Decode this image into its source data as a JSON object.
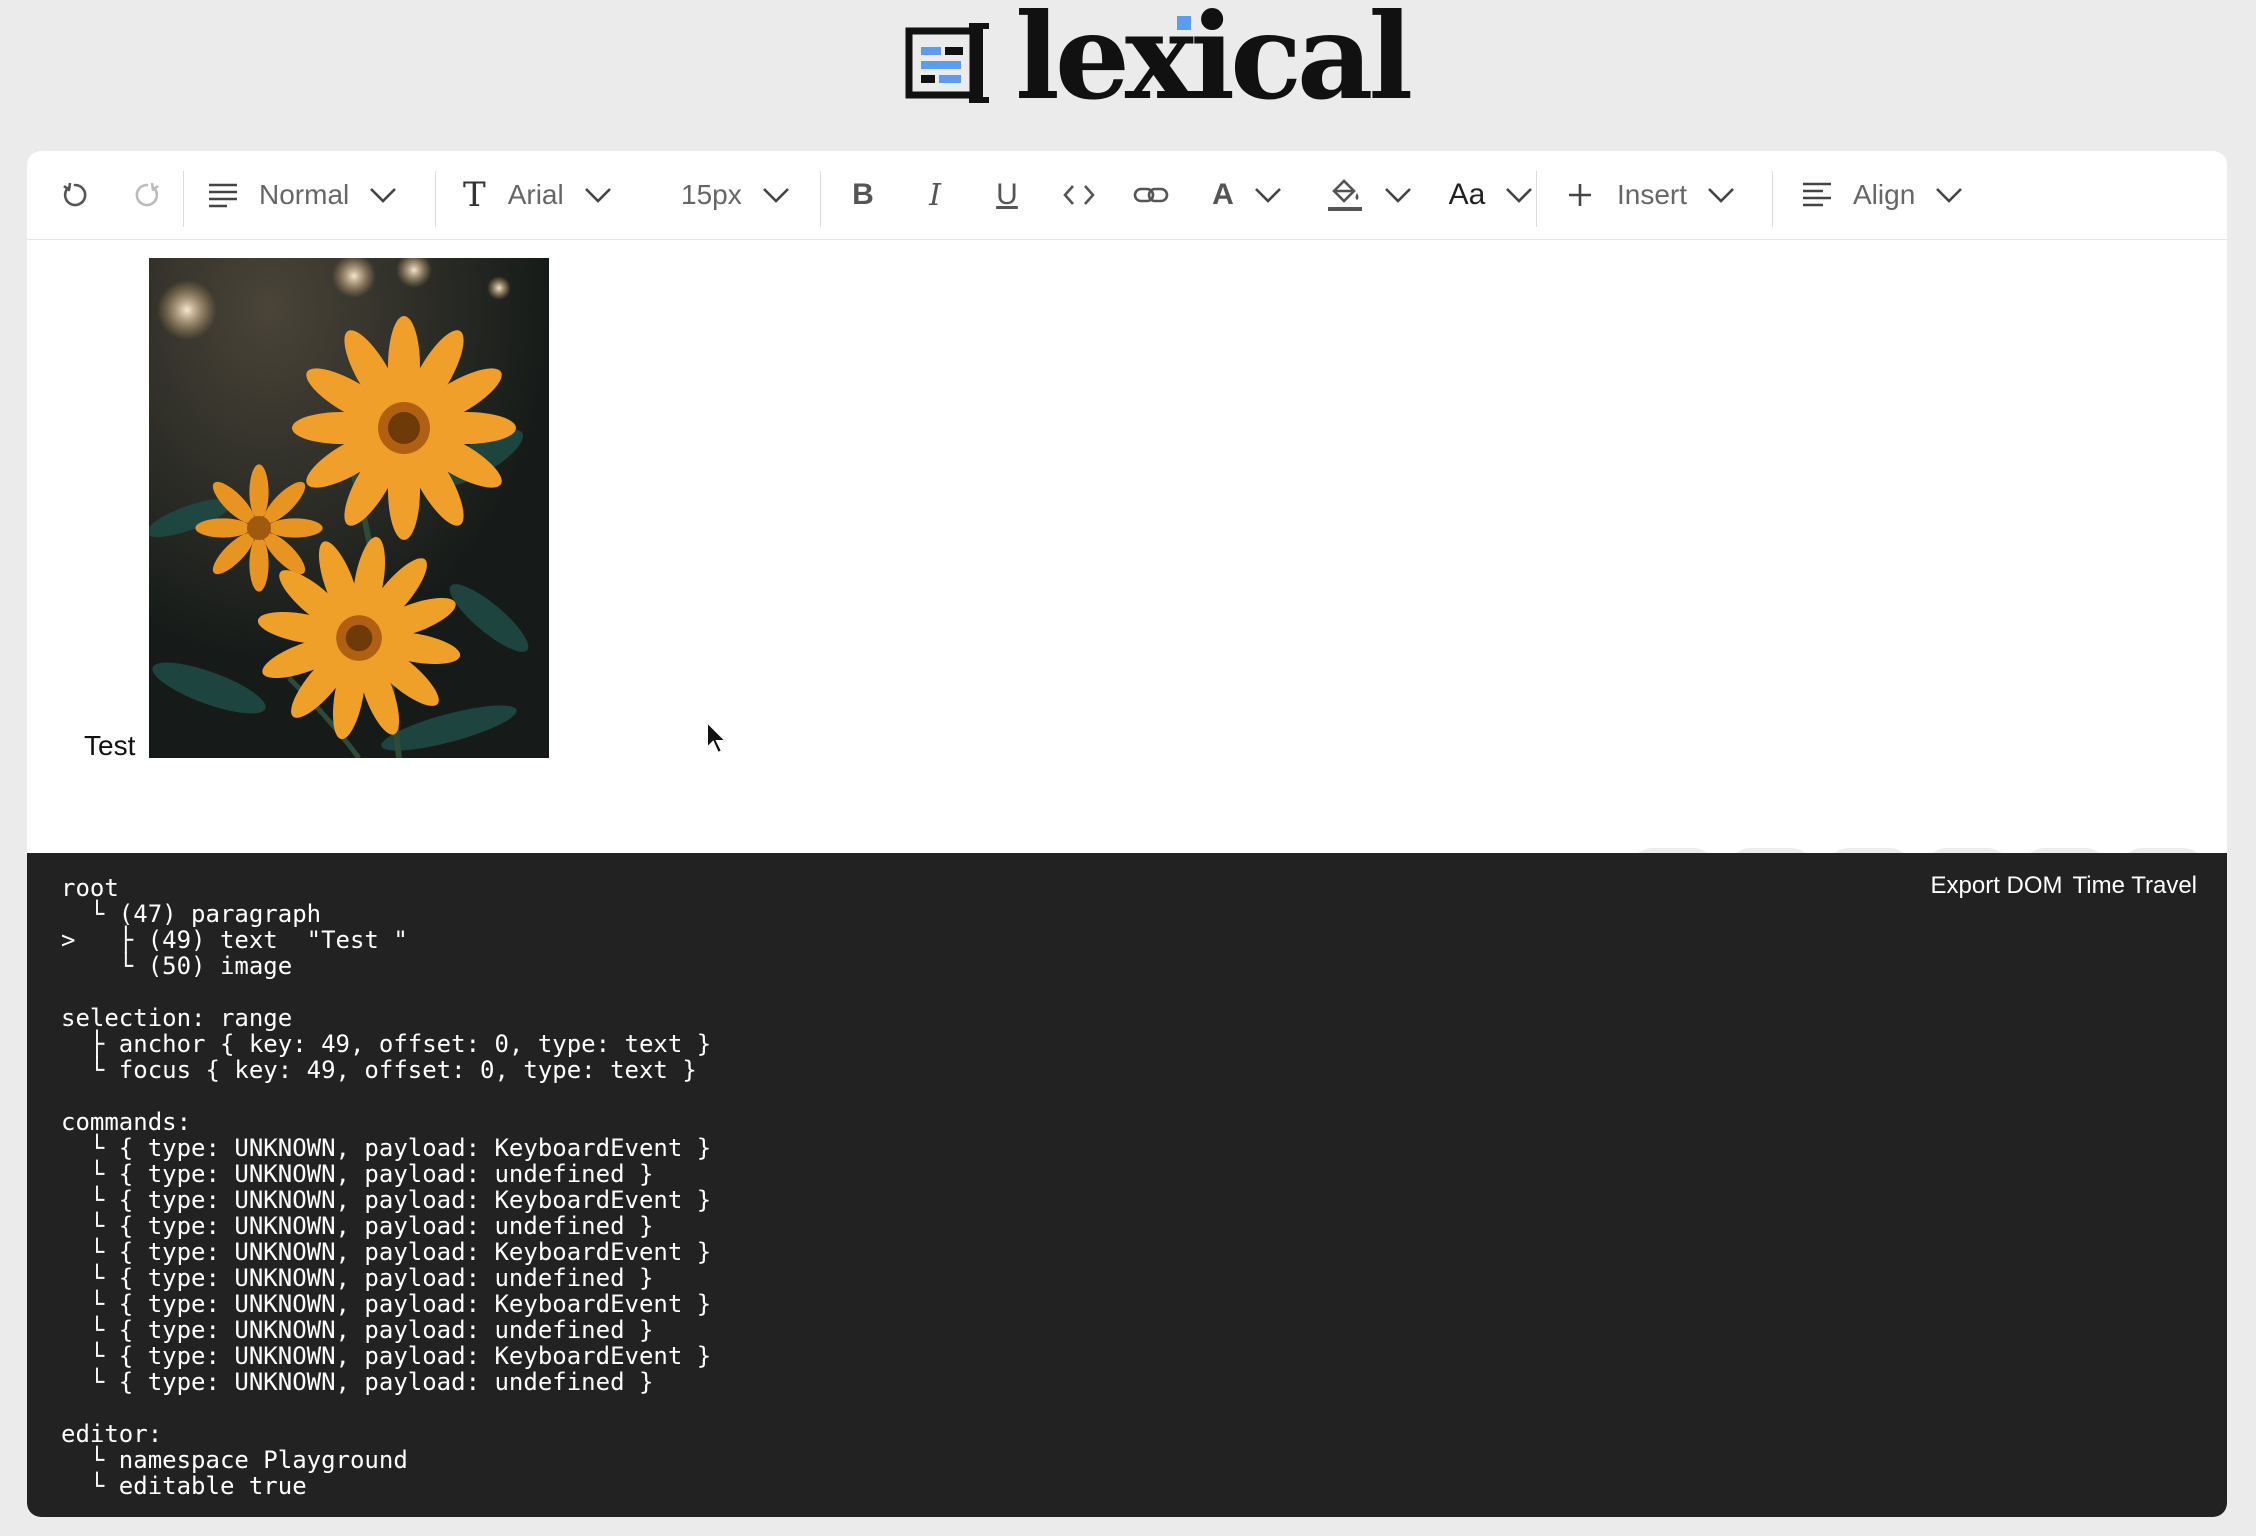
{
  "logo": {
    "text": "lexical"
  },
  "toolbar": {
    "block_type": "Normal",
    "font_family": "Arial",
    "font_size": "15px",
    "insert_label": "Insert",
    "align_label": "Align",
    "case_label": "Aa",
    "icons": [
      "undo-icon",
      "redo-icon",
      "paragraph-icon",
      "font-family-icon",
      "bold-icon",
      "italic-icon",
      "underline-icon",
      "code-icon",
      "link-icon",
      "font-color-icon",
      "bg-color-icon",
      "plus-icon",
      "align-left-icon"
    ]
  },
  "content": {
    "paragraph_text": "Test",
    "image_alt": "Orange daisy flowers"
  },
  "actions": [
    "microphone-icon",
    "import-icon",
    "export-icon",
    "trash-icon",
    "lock-icon",
    "markdown-icon"
  ],
  "tree_view": {
    "export_dom": "Export DOM",
    "time_travel": "Time Travel",
    "lines": [
      "root",
      "  └ (47) paragraph",
      ">   ├ (49) text  \"Test \"",
      "    └ (50) image",
      "",
      "selection: range",
      "  ├ anchor { key: 49, offset: 0, type: text }",
      "  └ focus { key: 49, offset: 0, type: text }",
      "",
      "commands:",
      "  └ { type: UNKNOWN, payload: KeyboardEvent }",
      "  └ { type: UNKNOWN, payload: undefined }",
      "  └ { type: UNKNOWN, payload: KeyboardEvent }",
      "  └ { type: UNKNOWN, payload: undefined }",
      "  └ { type: UNKNOWN, payload: KeyboardEvent }",
      "  └ { type: UNKNOWN, payload: undefined }",
      "  └ { type: UNKNOWN, payload: KeyboardEvent }",
      "  └ { type: UNKNOWN, payload: undefined }",
      "  └ { type: UNKNOWN, payload: KeyboardEvent }",
      "  └ { type: UNKNOWN, payload: undefined }",
      "",
      "editor:",
      "  └ namespace Playground",
      "  └ editable true"
    ]
  },
  "colors": {
    "accent": "#5b9cf0",
    "tree_bg": "#222222",
    "page_bg": "#ebebeb"
  }
}
